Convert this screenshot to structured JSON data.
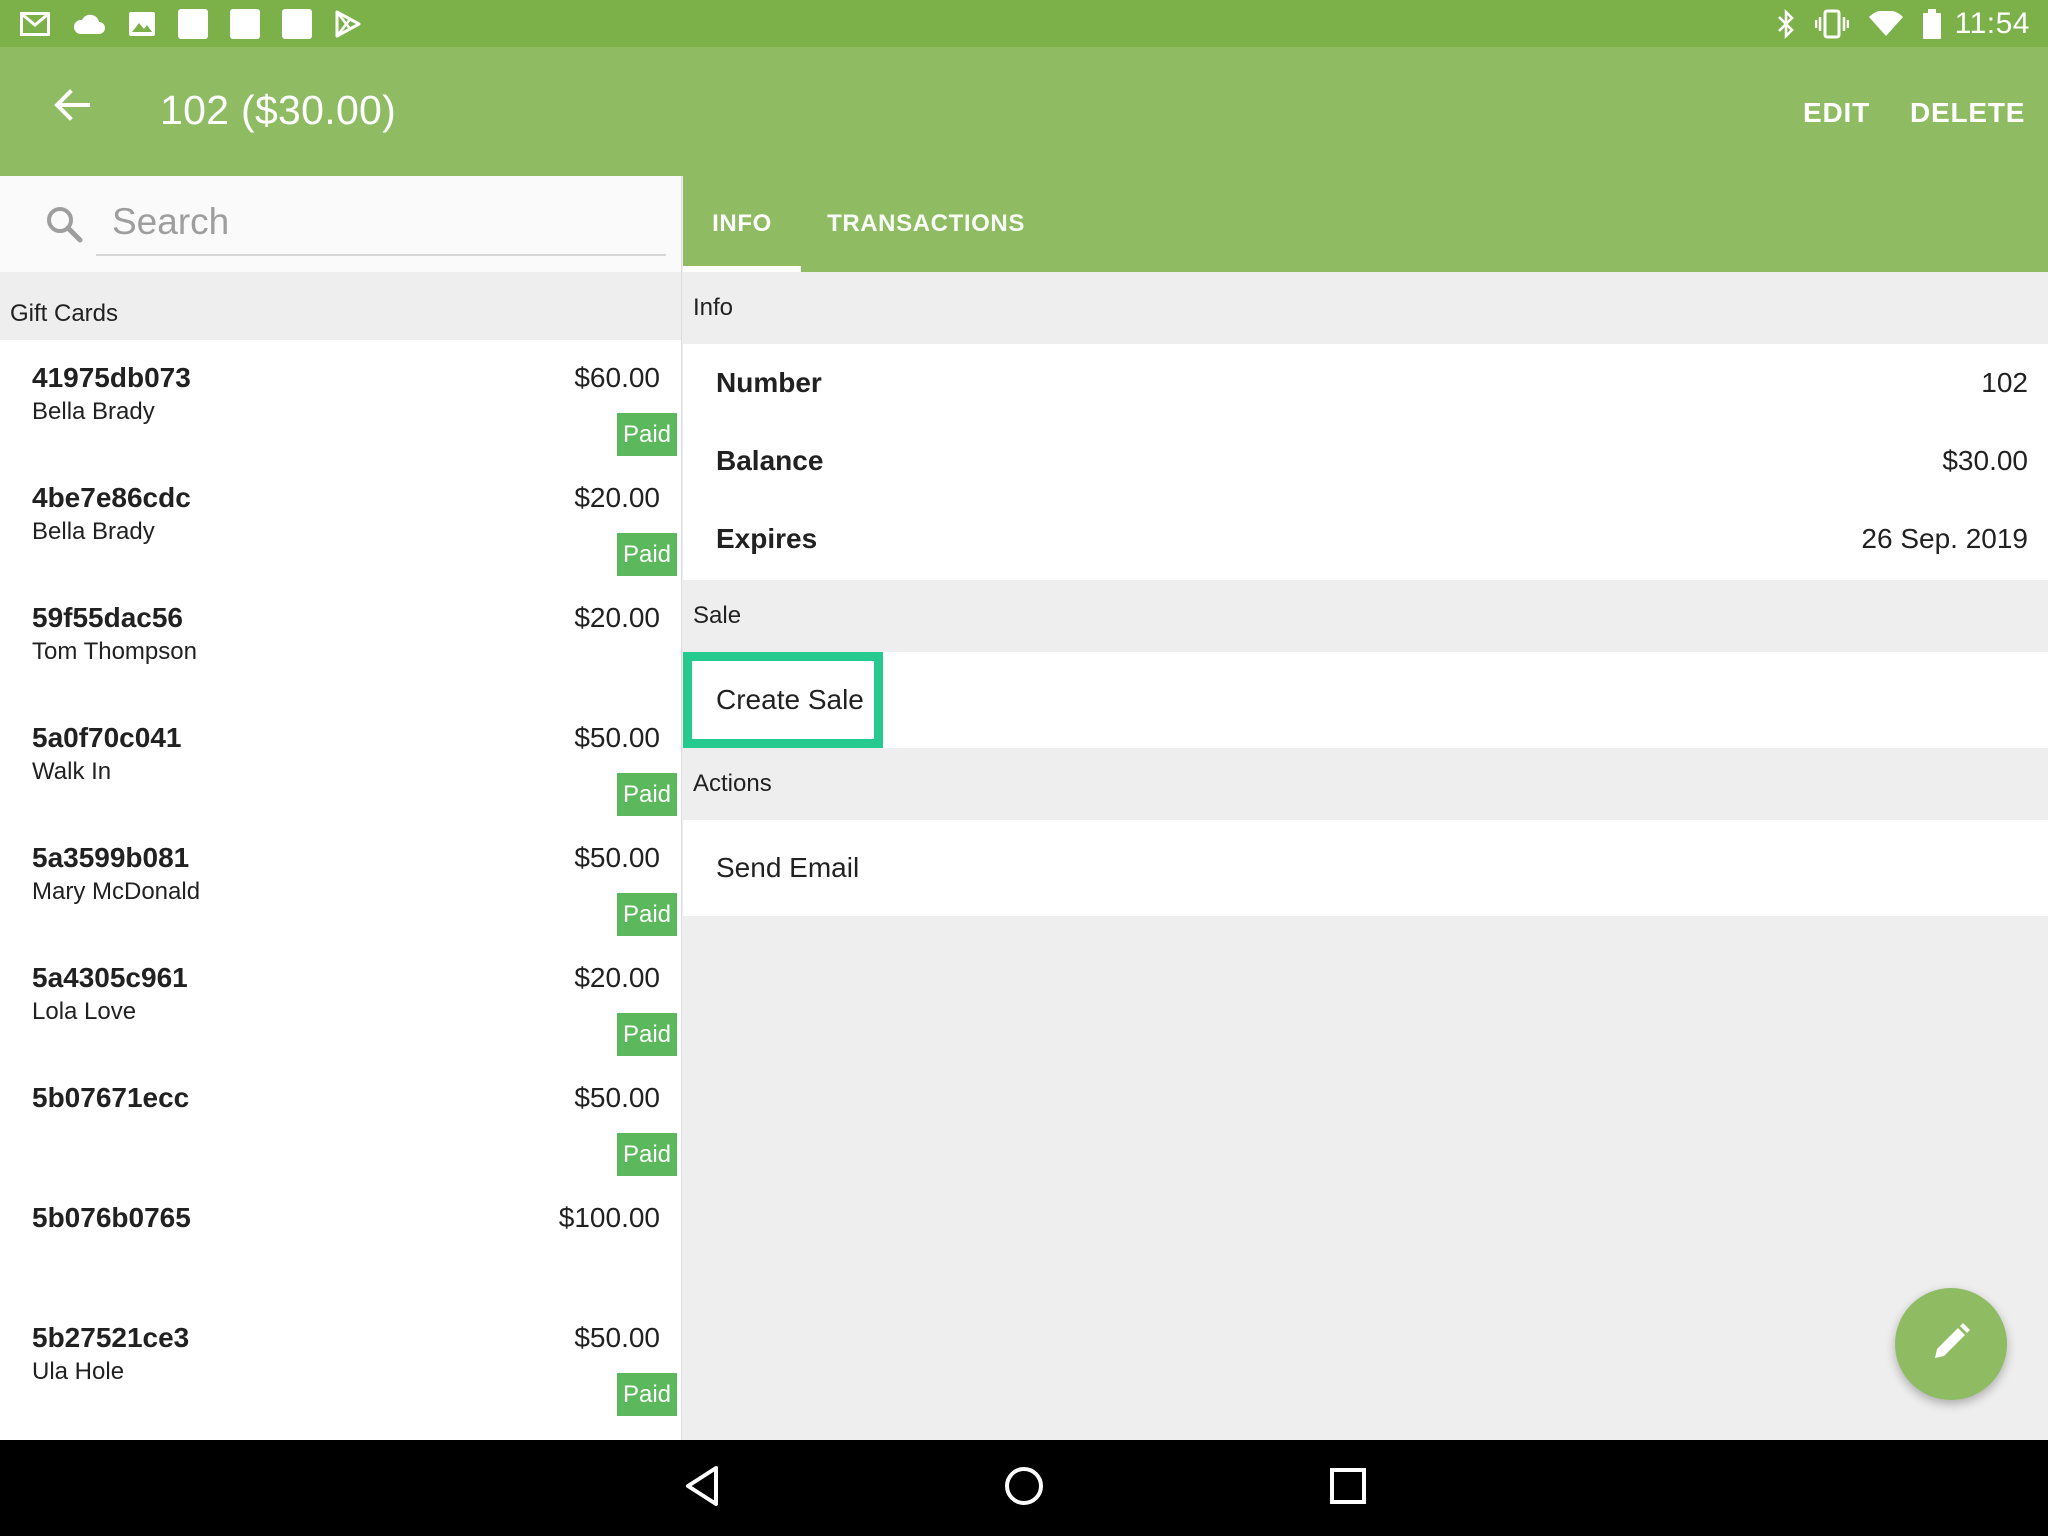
{
  "status_bar": {
    "time": "11:54",
    "left_icons": [
      "gmail-icon",
      "cloud-icon",
      "image-icon",
      "square-icon",
      "square-icon",
      "square-icon",
      "play-store-icon"
    ],
    "right_icons": [
      "bluetooth-icon",
      "vibrate-icon",
      "wifi-icon",
      "battery-icon"
    ]
  },
  "app_bar": {
    "title": "102 ($30.00)",
    "edit_label": "EDIT",
    "delete_label": "DELETE",
    "color": "#8fbc63"
  },
  "left_pane": {
    "search_placeholder": "Search",
    "list_header": "Gift Cards",
    "items": [
      {
        "number": "41975db073",
        "name": "Bella Brady",
        "amount": "$60.00",
        "badge": "Paid"
      },
      {
        "number": "4be7e86cdc",
        "name": "Bella Brady",
        "amount": "$20.00",
        "badge": "Paid"
      },
      {
        "number": "59f55dac56",
        "name": "Tom Thompson",
        "amount": "$20.00",
        "badge": ""
      },
      {
        "number": "5a0f70c041",
        "name": "Walk In",
        "amount": "$50.00",
        "badge": "Paid"
      },
      {
        "number": "5a3599b081",
        "name": "Mary McDonald",
        "amount": "$50.00",
        "badge": "Paid"
      },
      {
        "number": "5a4305c961",
        "name": "Lola Love",
        "amount": "$20.00",
        "badge": "Paid"
      },
      {
        "number": "5b07671ecc",
        "name": "",
        "amount": "$50.00",
        "badge": "Paid"
      },
      {
        "number": "5b076b0765",
        "name": "",
        "amount": "$100.00",
        "badge": ""
      },
      {
        "number": "5b27521ce3",
        "name": "Ula Hole",
        "amount": "$50.00",
        "badge": "Paid"
      }
    ],
    "badge_color": "#5cb85c"
  },
  "right_pane": {
    "tabs": [
      {
        "label": "INFO",
        "active": true
      },
      {
        "label": "TRANSACTIONS",
        "active": false
      }
    ],
    "info_header": "Info",
    "info_rows": [
      {
        "label": "Number",
        "value": "102"
      },
      {
        "label": "Balance",
        "value": "$30.00"
      },
      {
        "label": "Expires",
        "value": "26 Sep. 2019"
      }
    ],
    "sale_header": "Sale",
    "create_sale_label": "Create Sale",
    "highlight_color": "#26c98e",
    "actions_header": "Actions",
    "send_email_label": "Send Email"
  }
}
